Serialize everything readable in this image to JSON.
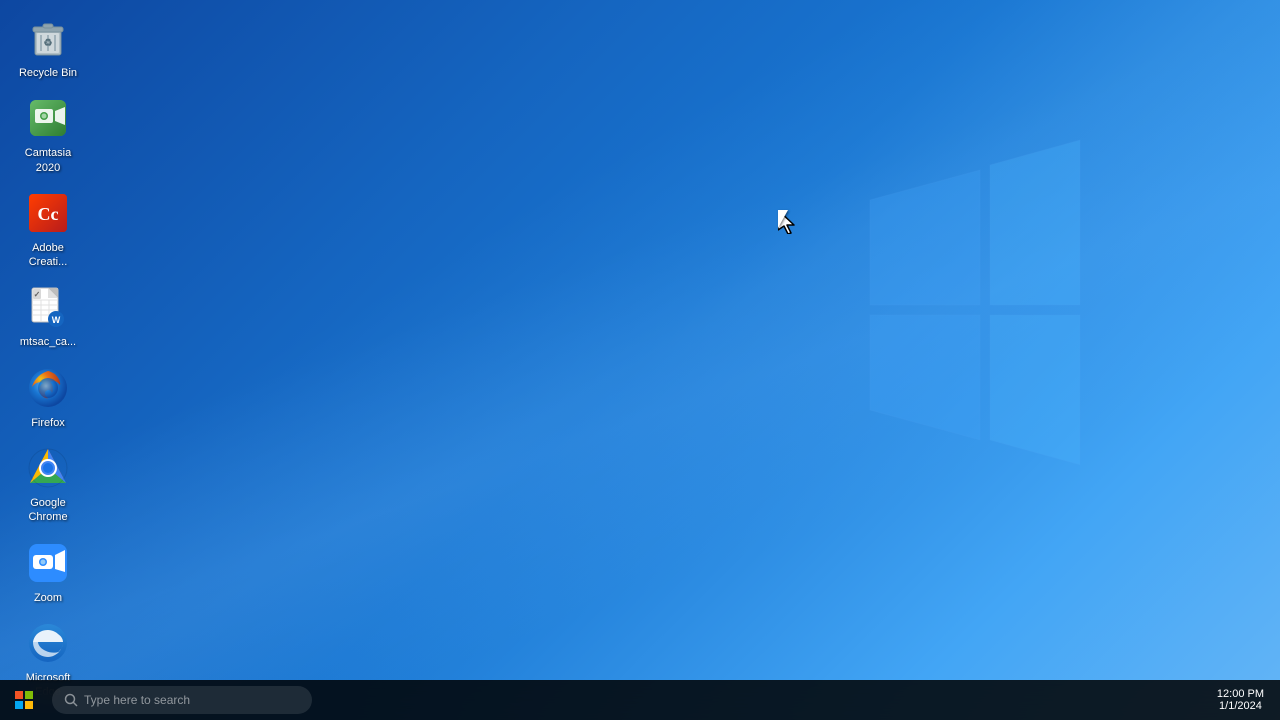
{
  "desktop": {
    "background": "Windows 10 blue desktop"
  },
  "icons": [
    {
      "id": "recycle-bin",
      "label": "Recycle Bin",
      "type": "recycle-bin"
    },
    {
      "id": "camtasia-2020",
      "label": "Camtasia 2020",
      "type": "camtasia"
    },
    {
      "id": "adobe-creative-cloud",
      "label": "Adobe Creati...",
      "type": "adobe"
    },
    {
      "id": "mtsac-cam",
      "label": "mtsac_ca...",
      "type": "file"
    },
    {
      "id": "firefox",
      "label": "Firefox",
      "type": "firefox"
    },
    {
      "id": "google-chrome",
      "label": "Google Chrome",
      "type": "chrome"
    },
    {
      "id": "zoom",
      "label": "Zoom",
      "type": "zoom"
    },
    {
      "id": "microsoft-edge",
      "label": "Microsoft Edge",
      "type": "edge"
    }
  ],
  "taskbar": {
    "search_placeholder": "Type here to search",
    "time": "12:00 PM",
    "date": "1/1/2024"
  }
}
